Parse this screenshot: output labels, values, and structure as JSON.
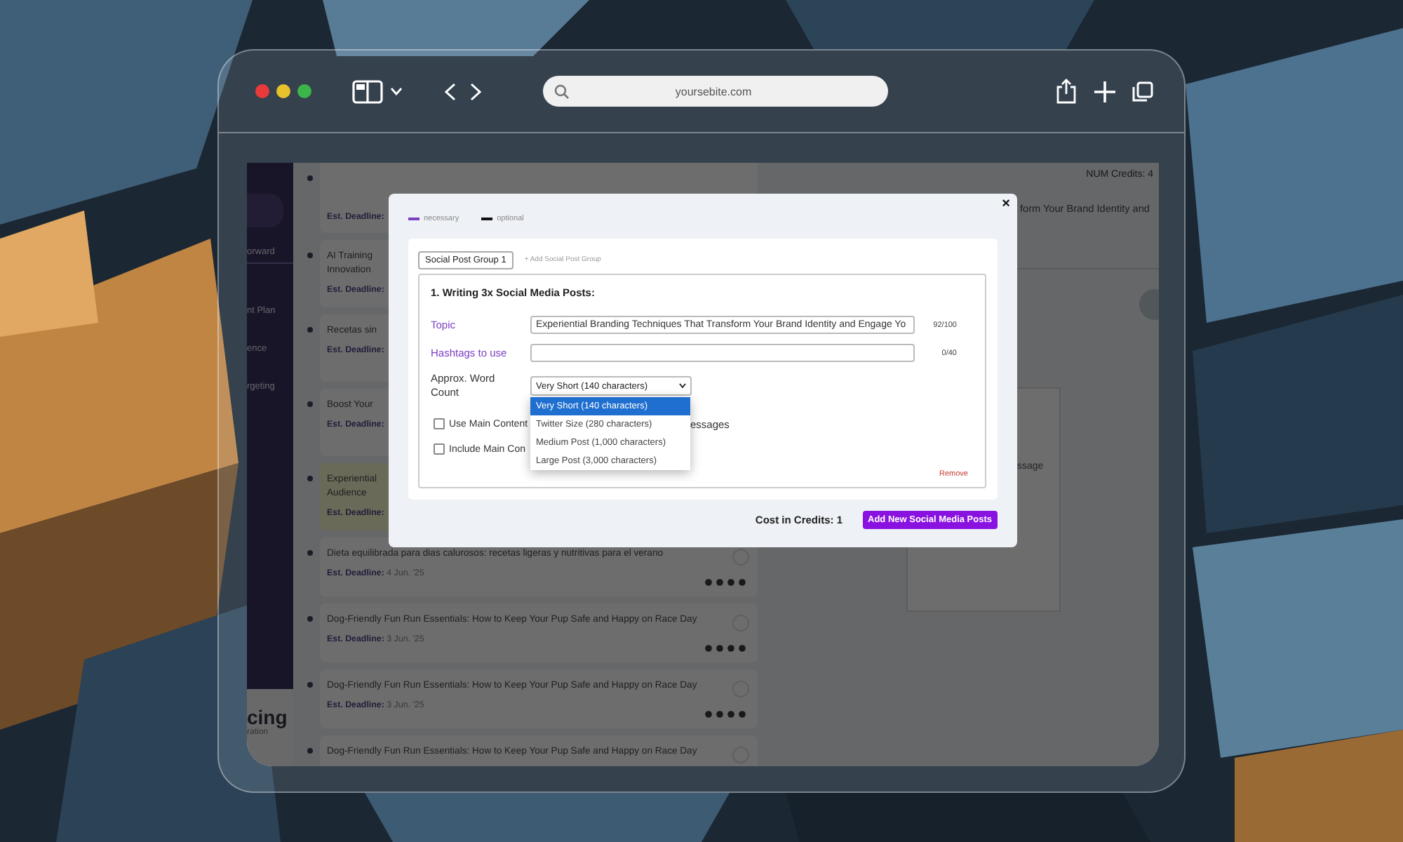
{
  "browser": {
    "url": "yoursebite.com"
  },
  "sidebar": {
    "items": [
      "orward",
      "nt Plan",
      "ence",
      "rgeting"
    ],
    "footer_title": "cing",
    "footer_subtitle": "ration"
  },
  "header": {
    "credits": "NUM Credits: 4"
  },
  "cards": [
    {
      "deadline_label": "Est. Deadline:",
      "selected": false
    },
    {
      "title_lines": [
        "AI Training",
        "Innovation"
      ],
      "deadline_label": "Est. Deadline:",
      "selected": false
    },
    {
      "title_lines": [
        "Recetas sin"
      ],
      "deadline_label": "Est. Deadline:",
      "selected": false
    },
    {
      "title_lines": [
        "Boost Your"
      ],
      "deadline_label": "Est. Deadline:",
      "selected": false
    },
    {
      "title_lines": [
        "Experiential",
        "Audience"
      ],
      "deadline_label": "Est. Deadline:",
      "selected": true
    },
    {
      "title_lines": [
        "Dieta equilibrada para dias calurosos: recetas ligeras y nutritivas para el verano"
      ],
      "deadline_label": "Est. Deadline:",
      "deadline": "4 Jun. '25",
      "selected": false
    },
    {
      "title_lines": [
        "Dog-Friendly Fun Run Essentials: How to Keep Your Pup Safe and Happy on Race Day"
      ],
      "deadline_label": "Est. Deadline:",
      "deadline": "3 Jun. '25",
      "selected": false
    },
    {
      "title_lines": [
        "Dog-Friendly Fun Run Essentials: How to Keep Your Pup Safe and Happy on Race Day"
      ],
      "deadline_label": "Est. Deadline:",
      "deadline": "3 Jun. '25",
      "selected": false
    },
    {
      "title_lines": [
        "Dog-Friendly Fun Run Essentials: How to Keep Your Pup Safe and Happy on Race Day"
      ],
      "selected": false
    }
  ],
  "detail": {
    "title": "form Your Brand Identity and",
    "message_fragment": "ssage"
  },
  "modal": {
    "close": "×",
    "legend": [
      {
        "label": "necessary",
        "color": "#7b3fc4"
      },
      {
        "label": "optional",
        "color": "#111111"
      }
    ],
    "tabs": [
      {
        "label": "Social Post Group 1",
        "selected": true
      }
    ],
    "add_tab": "+ Add Social Post Group",
    "section_title": "1. Writing 3x Social Media Posts:",
    "fields": [
      {
        "kind": "text",
        "label": "Topic",
        "necessary": true,
        "value": "Experiential Branding Techniques That Transform Your Brand Identity and Engage Yo",
        "counter": "92/100"
      },
      {
        "kind": "text",
        "label": "Hashtags to use",
        "necessary": true,
        "counter": "0/40"
      },
      {
        "kind": "select",
        "label": "Approx. Word Count",
        "necessary": false,
        "value": "Very Short (140 characters)",
        "expanded": true,
        "options": [
          {
            "label": "Very Short (140 characters)",
            "selected": true
          },
          {
            "label": "Twitter Size (280 characters)",
            "selected": false
          },
          {
            "label": "Medium Post (1,000 characters)",
            "selected": false
          },
          {
            "label": "Large Post (3,000 characters)",
            "selected": false
          }
        ]
      }
    ],
    "checkboxes": [
      {
        "label": "Use Main Content",
        "label_tail": "essages",
        "checked": false
      },
      {
        "label": "Include Main Con",
        "checked": false
      }
    ],
    "remove": "Remove",
    "cost": "Cost in Credits: 1",
    "submit": "Add New Social Media Posts"
  }
}
